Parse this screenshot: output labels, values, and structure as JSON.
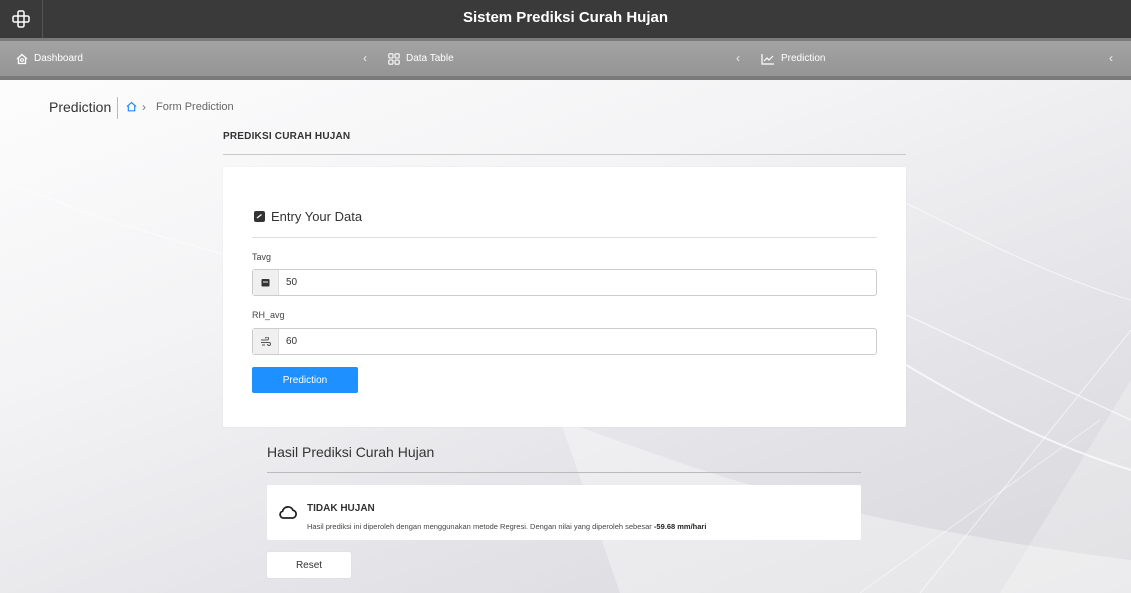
{
  "app": {
    "title": "Sistem Prediksi Curah Hujan",
    "logo_icon": "app-logo-icon"
  },
  "nav": {
    "items": [
      {
        "label": "Dashboard",
        "icon": "home-icon"
      },
      {
        "label": "Data Table",
        "icon": "grid-icon"
      },
      {
        "label": "Prediction",
        "icon": "line-chart-icon"
      }
    ],
    "chevron": "‹"
  },
  "breadcrumb": {
    "title": "Prediction",
    "separator": "›",
    "current": "Form Prediction"
  },
  "page": {
    "section_title": "PREDIKSI CURAH HUJAN"
  },
  "form": {
    "heading": "Entry Your Data",
    "fields": [
      {
        "label": "Tavg",
        "value": "50",
        "icon": "calendar-icon"
      },
      {
        "label": "RH_avg",
        "value": "60",
        "icon": "wind-icon"
      }
    ],
    "submit_label": "Prediction"
  },
  "result": {
    "title": "Hasil Prediksi Curah Hujan",
    "status": "TIDAK HUJAN",
    "description": "Hasil prediksi ini diperoleh dengan menggunakan metode Regresi. Dengan nilai yang diperoleh sebesar",
    "value": "-59.68 mm/hari",
    "icon": "cloud-icon"
  },
  "reset_label": "Reset",
  "colors": {
    "topbar": "#3a3a3a",
    "navbar": "#9c9c9c",
    "primary": "#1e90ff",
    "accent_home": "#1e90ff"
  }
}
